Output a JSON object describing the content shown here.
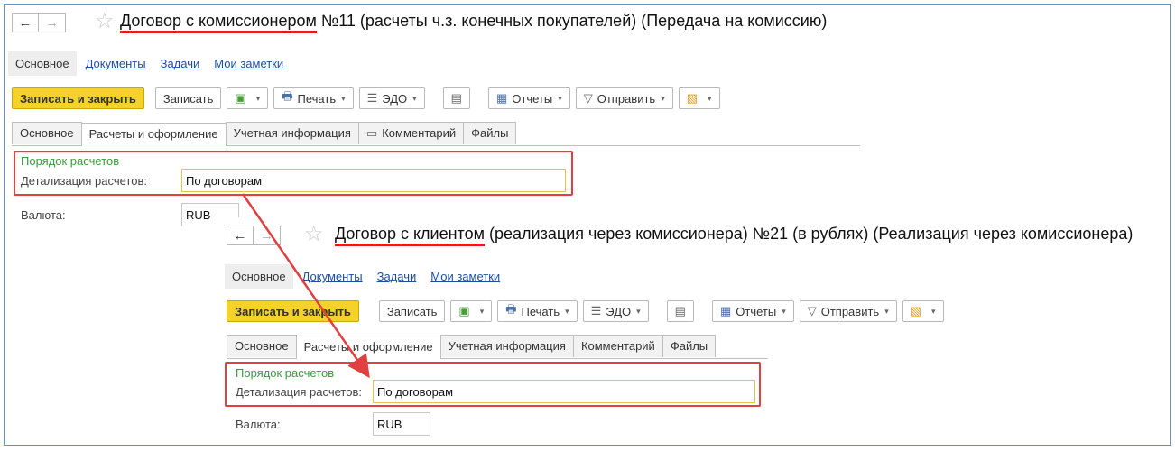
{
  "windows": [
    {
      "title_underlined": "Договор с комиссионером",
      "title_rest": " №11 (расчеты ч.з. конечных покупателей) (Передача на комиссию)",
      "subnav": {
        "active": "Основное",
        "links": [
          "Документы",
          "Задачи",
          "Мои заметки"
        ]
      },
      "toolbar": {
        "save_close": "Записать и закрыть",
        "save": "Записать",
        "print": "Печать",
        "edo": "ЭДО",
        "reports": "Отчеты",
        "send": "Отправить"
      },
      "tabs": [
        "Основное",
        "Расчеты и оформление",
        "Учетная информация",
        "Комментарий",
        "Файлы"
      ],
      "section_title": "Порядок расчетов",
      "detail_label": "Детализация расчетов:",
      "detail_value": "По договорам",
      "currency_label": "Валюта:",
      "currency_value": "RUB"
    },
    {
      "title_underlined": "Договор с клиентом",
      "title_rest": " (реализация через комиссионера) №21 (в рублях) (Реализация через комиссионера)",
      "subnav": {
        "active": "Основное",
        "links": [
          "Документы",
          "Задачи",
          "Мои заметки"
        ]
      },
      "toolbar": {
        "save_close": "Записать и закрыть",
        "save": "Записать",
        "print": "Печать",
        "edo": "ЭДО",
        "reports": "Отчеты",
        "send": "Отправить"
      },
      "tabs": [
        "Основное",
        "Расчеты и оформление",
        "Учетная информация",
        "Комментарий",
        "Файлы"
      ],
      "section_title": "Порядок расчетов",
      "detail_label": "Детализация расчетов:",
      "detail_value": "По договорам",
      "currency_label": "Валюта:",
      "currency_value": "RUB"
    }
  ],
  "icons": {
    "back": "←",
    "forward": "→",
    "star": "☆",
    "dropdown": "▾",
    "structure": "▣",
    "print": "🖶",
    "edo": "☰",
    "doc": "▤",
    "reports": "▦",
    "send": "▽",
    "attach": "▧",
    "comment": "▭"
  },
  "colors": {
    "accent": "#f4d229",
    "link": "#1f4ea1",
    "section": "#3a9a3a",
    "highlight": "#e04040"
  }
}
